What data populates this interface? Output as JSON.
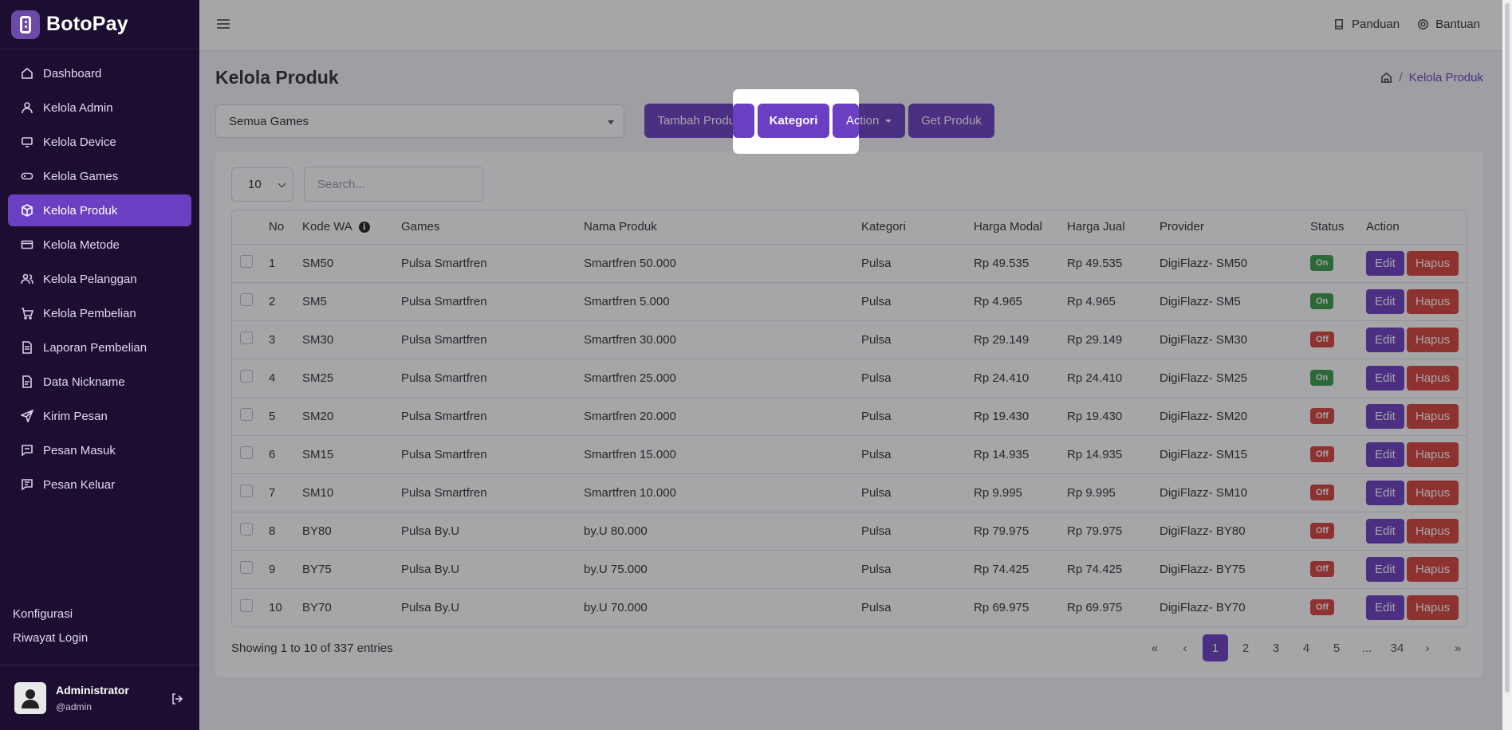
{
  "brand": {
    "name": "BotoPay"
  },
  "sidebar": {
    "items": [
      {
        "label": "Dashboard",
        "icon": "home-icon"
      },
      {
        "label": "Kelola Admin",
        "icon": "user-icon"
      },
      {
        "label": "Kelola Device",
        "icon": "device-icon"
      },
      {
        "label": "Kelola Games",
        "icon": "gamepad-icon"
      },
      {
        "label": "Kelola Produk",
        "icon": "box-icon",
        "active": true
      },
      {
        "label": "Kelola Metode",
        "icon": "credit-card-icon"
      },
      {
        "label": "Kelola Pelanggan",
        "icon": "users-icon"
      },
      {
        "label": "Kelola Pembelian",
        "icon": "cart-icon"
      },
      {
        "label": "Laporan Pembelian",
        "icon": "document-icon"
      },
      {
        "label": "Data Nickname",
        "icon": "file-icon"
      },
      {
        "label": "Kirim Pesan",
        "icon": "send-icon"
      },
      {
        "label": "Pesan Masuk",
        "icon": "message-icon"
      },
      {
        "label": "Pesan Keluar",
        "icon": "message-out-icon"
      }
    ],
    "footer_links": [
      "Konfigurasi",
      "Riwayat Login"
    ],
    "user": {
      "name": "Administrator",
      "handle": "@admin"
    }
  },
  "topbar": {
    "links": [
      {
        "label": "Panduan",
        "icon": "book-icon"
      },
      {
        "label": "Bantuan",
        "icon": "lifebuoy-icon"
      }
    ]
  },
  "page": {
    "title": "Kelola Produk",
    "breadcrumb_current": "Kelola Produk"
  },
  "toolbar": {
    "games_select": "Semua Games",
    "tambah_label": "Tambah Produk",
    "kategori_label": "Kategori",
    "action_label": "Action",
    "get_label": "Get Produk"
  },
  "table_controls": {
    "length": "10",
    "search_placeholder": "Search..."
  },
  "table": {
    "columns": [
      "No",
      "Kode WA",
      "Games",
      "Nama Produk",
      "Kategori",
      "Harga Modal",
      "Harga Jual",
      "Provider",
      "Status",
      "Action"
    ],
    "rows": [
      {
        "no": "1",
        "kode": "SM50",
        "games": "Pulsa Smartfren",
        "nama": "Smartfren 50.000",
        "kategori": "Pulsa",
        "modal": "Rp 49.535",
        "jual": "Rp 49.535",
        "provider": "DigiFlazz- SM50",
        "status": "On"
      },
      {
        "no": "2",
        "kode": "SM5",
        "games": "Pulsa Smartfren",
        "nama": "Smartfren 5.000",
        "kategori": "Pulsa",
        "modal": "Rp 4.965",
        "jual": "Rp 4.965",
        "provider": "DigiFlazz- SM5",
        "status": "On"
      },
      {
        "no": "3",
        "kode": "SM30",
        "games": "Pulsa Smartfren",
        "nama": "Smartfren 30.000",
        "kategori": "Pulsa",
        "modal": "Rp 29.149",
        "jual": "Rp 29.149",
        "provider": "DigiFlazz- SM30",
        "status": "Off"
      },
      {
        "no": "4",
        "kode": "SM25",
        "games": "Pulsa Smartfren",
        "nama": "Smartfren 25.000",
        "kategori": "Pulsa",
        "modal": "Rp 24.410",
        "jual": "Rp 24.410",
        "provider": "DigiFlazz- SM25",
        "status": "On"
      },
      {
        "no": "5",
        "kode": "SM20",
        "games": "Pulsa Smartfren",
        "nama": "Smartfren 20.000",
        "kategori": "Pulsa",
        "modal": "Rp 19.430",
        "jual": "Rp 19.430",
        "provider": "DigiFlazz- SM20",
        "status": "Off"
      },
      {
        "no": "6",
        "kode": "SM15",
        "games": "Pulsa Smartfren",
        "nama": "Smartfren 15.000",
        "kategori": "Pulsa",
        "modal": "Rp 14.935",
        "jual": "Rp 14.935",
        "provider": "DigiFlazz- SM15",
        "status": "Off"
      },
      {
        "no": "7",
        "kode": "SM10",
        "games": "Pulsa Smartfren",
        "nama": "Smartfren 10.000",
        "kategori": "Pulsa",
        "modal": "Rp 9.995",
        "jual": "Rp 9.995",
        "provider": "DigiFlazz- SM10",
        "status": "Off"
      },
      {
        "no": "8",
        "kode": "BY80",
        "games": "Pulsa By.U",
        "nama": "by.U 80.000",
        "kategori": "Pulsa",
        "modal": "Rp 79.975",
        "jual": "Rp 79.975",
        "provider": "DigiFlazz- BY80",
        "status": "Off"
      },
      {
        "no": "9",
        "kode": "BY75",
        "games": "Pulsa By.U",
        "nama": "by.U 75.000",
        "kategori": "Pulsa",
        "modal": "Rp 74.425",
        "jual": "Rp 74.425",
        "provider": "DigiFlazz- BY75",
        "status": "Off"
      },
      {
        "no": "10",
        "kode": "BY70",
        "games": "Pulsa By.U",
        "nama": "by.U 70.000",
        "kategori": "Pulsa",
        "modal": "Rp 69.975",
        "jual": "Rp 69.975",
        "provider": "DigiFlazz- BY70",
        "status": "Off"
      }
    ],
    "edit_label": "Edit",
    "hapus_label": "Hapus"
  },
  "footer": {
    "entries_info": "Showing 1 to 10 of 337 entries",
    "pages": [
      "«",
      "‹",
      "1",
      "2",
      "3",
      "4",
      "5",
      "...",
      "34",
      "›",
      "»"
    ],
    "active_page": "1"
  },
  "colors": {
    "primary": "#6b3fc1",
    "sidebar_bg": "#1f0a3d",
    "danger": "#d9443a",
    "success": "#3a9b4a"
  }
}
